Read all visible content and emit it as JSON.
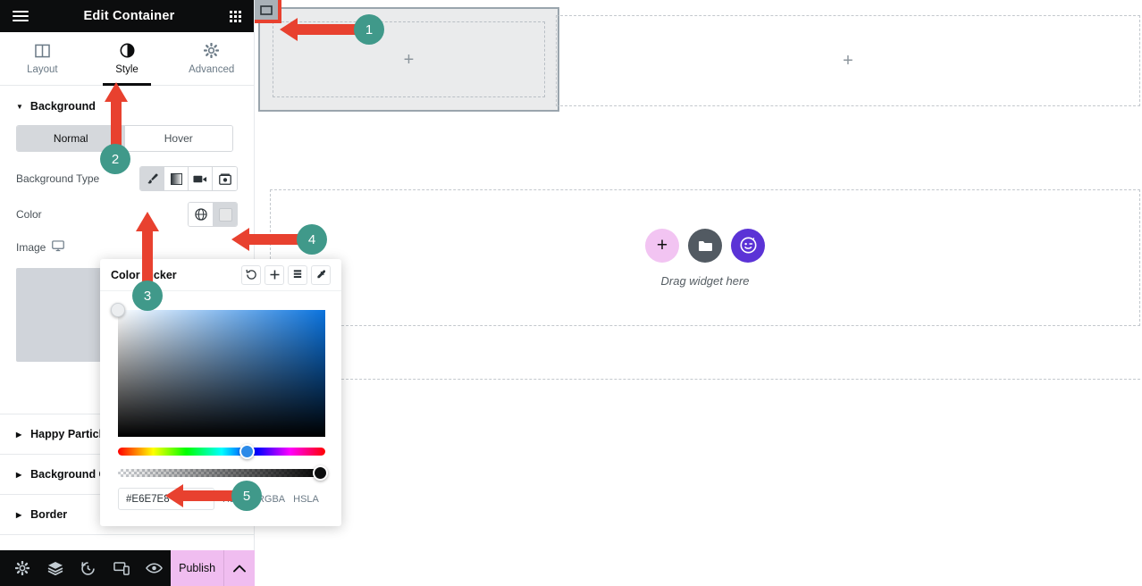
{
  "panel": {
    "header": {
      "title": "Edit Container",
      "menu_icon": "hamburger-icon",
      "widgets_icon": "grid-icon"
    },
    "tabs": [
      {
        "label": "Layout",
        "icon": "layout-columns-icon",
        "active": false
      },
      {
        "label": "Style",
        "icon": "contrast-circle-icon",
        "active": true
      },
      {
        "label": "Advanced",
        "icon": "gear-icon",
        "active": false
      }
    ],
    "background_section": {
      "title": "Background",
      "state_switcher": {
        "options": [
          "Normal",
          "Hover"
        ],
        "selected": "Normal"
      },
      "background_type": {
        "label": "Background Type",
        "options": [
          "classic-brush-icon",
          "gradient-icon",
          "video-camera-icon",
          "slideshow-icon"
        ],
        "selected_index": 0
      },
      "color": {
        "label": "Color",
        "global_icon": "globe-icon",
        "swatch_value": "#E6E7E8"
      },
      "image": {
        "label": "Image",
        "responsive_icon": "monitor-icon"
      }
    },
    "accordion": [
      {
        "label": "Happy Particles",
        "truncated": "Happy Particl"
      },
      {
        "label": "Background Overlay",
        "truncated": "Background O"
      },
      {
        "label": "Border",
        "truncated": "Border"
      }
    ],
    "bottom_bar": {
      "icons": [
        "settings-gear-icon",
        "layers-icon",
        "history-clock-icon",
        "responsive-devices-icon",
        "preview-eye-icon"
      ],
      "publish_label": "Publish",
      "publish_toggle_icon": "chevron-up-icon",
      "publish_color": "#F0BDF0"
    }
  },
  "canvas": {
    "selected_container": {
      "handle_icon": "container-handle-icon",
      "add_glyph": "+",
      "background_color": "#EAEBEC",
      "border_color": "#9AA5AD"
    },
    "empty_container_right": {
      "add_glyph": "+"
    },
    "dropzone": {
      "label": "Drag widget here",
      "buttons": [
        {
          "name": "add-element-button",
          "icon": "plus-icon",
          "color": "#F2C4F2"
        },
        {
          "name": "add-template-button",
          "icon": "folder-icon",
          "color": "#525A62"
        },
        {
          "name": "ai-button",
          "icon": "ai-face-icon",
          "color": "#5B33D6"
        }
      ]
    }
  },
  "color_picker": {
    "title": "Color Picker",
    "tools": [
      "undo-icon",
      "add-swatch-icon",
      "swatch-list-icon",
      "eyedropper-icon"
    ],
    "hex_value": "#E6E7E8",
    "formats": [
      "HEXA",
      "RGBA",
      "HSLA"
    ],
    "hue_position_pct": 59,
    "alpha_position_pct": 100
  },
  "annotations": {
    "accent_arrow_color": "#E8412F",
    "badge_color": "#40998A",
    "steps": [
      {
        "number": "1",
        "target": "container-handle"
      },
      {
        "number": "2",
        "target": "style-tab"
      },
      {
        "number": "3",
        "target": "background-type-classic"
      },
      {
        "number": "4",
        "target": "color-swatch"
      },
      {
        "number": "5",
        "target": "hex-input"
      }
    ]
  }
}
